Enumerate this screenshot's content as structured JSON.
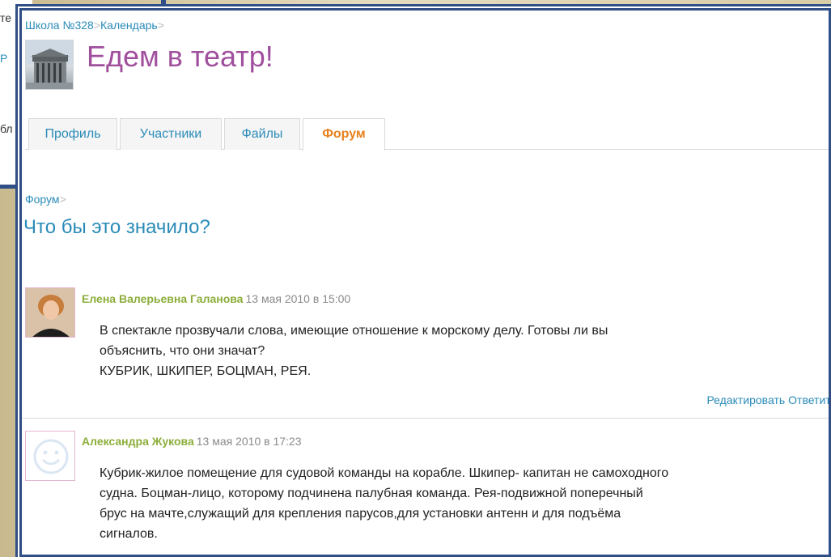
{
  "background_page": {
    "fragments": [
      "те",
      "Р",
      "бл"
    ]
  },
  "breadcrumb": {
    "items": [
      "Школа №328",
      "Календарь"
    ],
    "separator": ">"
  },
  "event": {
    "title": "Едем в театр!",
    "photo_icon": "theater-building-photo"
  },
  "tabs": [
    {
      "label": "Профиль",
      "active": false
    },
    {
      "label": "Участники",
      "active": false
    },
    {
      "label": "Файлы",
      "active": false
    },
    {
      "label": "Форум",
      "active": true
    }
  ],
  "forum": {
    "breadcrumb": "Форум",
    "separator": ">",
    "topic_title": "Что бы это значило?"
  },
  "posts": [
    {
      "author": "Елена Валерьевна Галанова",
      "date": "13 мая 2010 в 15:00",
      "avatar_icon": "user-photo",
      "lines": [
        "В спектакле прозвучали слова, имеющие отношение к морскому делу. Готовы ли вы",
        "объяснить, что они значат?",
        "КУБРИК, ШКИПЕР, БОЦМАН, РЕЯ."
      ],
      "actions": [
        "Редактировать",
        "Ответить"
      ]
    },
    {
      "author": "Александра Жукова",
      "date": "13 мая 2010 в 17:23",
      "avatar_icon": "smiley-placeholder-icon",
      "lines": [
        "Кубрик-жилое помещение для судовой команды на корабле. Шкипер- капитан не самоходного",
        "судна. Боцман-лицо, которому подчинена палубная команда. Рея-подвижной поперечный",
        "брус на мачте,служащий для крепления парусов,для установки антенн и для подъёма",
        "сигналов."
      ]
    }
  ],
  "colors": {
    "link": "#2a8bb8",
    "event_title": "#a04f9d",
    "active_tab": "#e8811c",
    "author": "#8cae3a",
    "frame": "#2f4f86"
  }
}
